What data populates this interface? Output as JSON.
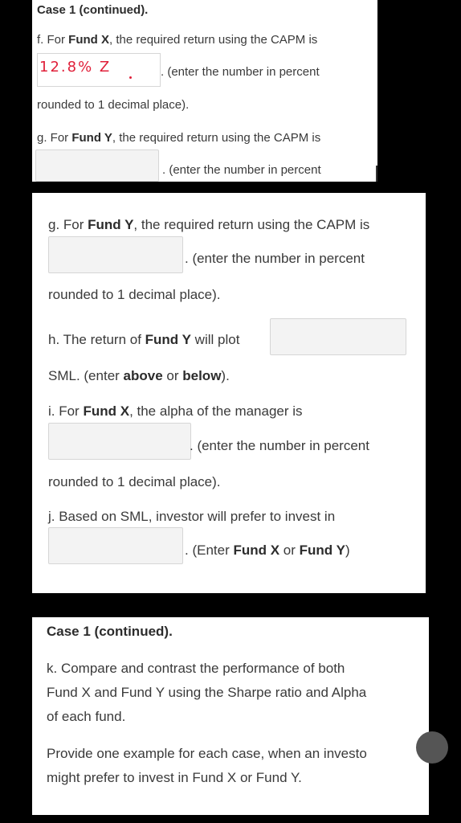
{
  "panel1": {
    "header": "Case 1 (continued).",
    "f_prefix": "f. For ",
    "f_bold": "Fund X",
    "f_suffix": ", the required return using the CAPM is",
    "f_answer": "12.8%",
    "f_answer_extra": "Z",
    "f_after": ". (enter the number in percent",
    "f_tail": "rounded to 1 decimal place).",
    "g_prefix": "g. For ",
    "g_bold": "Fund Y",
    "g_suffix": ", the required return using the CAPM is",
    "g_after": ". (enter the number in percent"
  },
  "panel2": {
    "g_prefix": "g. For ",
    "g_bold": "Fund Y",
    "g_suffix": ", the required return using the CAPM is",
    "g_after": ". (enter the number in percent",
    "g_tail": "rounded to 1 decimal place).",
    "h_prefix": "h. The return of ",
    "h_bold": "Fund Y",
    "h_suffix": " will plot",
    "h_tail_1": "SML. (enter ",
    "h_above": "above",
    "h_or": " or ",
    "h_below": "below",
    "h_tail_2": ").",
    "i_prefix": "i. For ",
    "i_bold": "Fund X",
    "i_suffix": ", the alpha of the manager is",
    "i_after": ". (enter the number in percent",
    "i_tail": "rounded to 1 decimal place).",
    "j_text": "j. Based on SML, investor will prefer to invest in",
    "j_after_1": ". (Enter ",
    "j_fundx": "Fund X",
    "j_or": " or ",
    "j_fundy": "Fund Y",
    "j_after_2": ")"
  },
  "panel3": {
    "header": "Case 1 (continued).",
    "k_line1": "k. Compare and contrast the performance of both",
    "k_line2": "Fund X and Fund Y using the Sharpe ratio and Alpha",
    "k_line3": "of each fund.",
    "p_line1": "Provide one example for each case, when an investo",
    "p_line2": "might prefer to invest in Fund X or Fund Y."
  }
}
